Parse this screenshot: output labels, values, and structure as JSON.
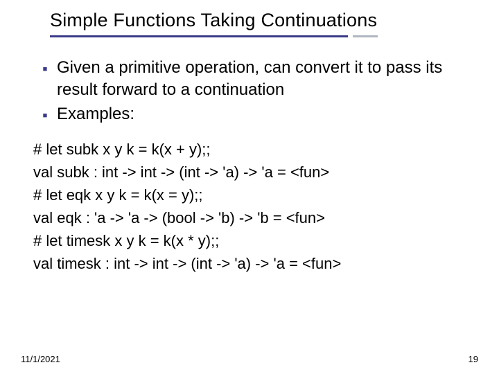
{
  "slide": {
    "title": "Simple Functions Taking Continuations",
    "bullets": [
      "Given a primitive operation, can convert it to pass its result forward to a continuation",
      "Examples:"
    ],
    "code_lines": [
      "# let subk x y k = k(x + y);;",
      "val subk : int -> int -> (int -> 'a) -> 'a = <fun>",
      "# let eqk x y k = k(x = y);;",
      "val eqk : 'a -> 'a -> (bool -> 'b) -> 'b = <fun>",
      "# let timesk x y k = k(x * y);;",
      "val timesk : int -> int -> (int -> 'a) -> 'a = <fun>"
    ],
    "footer_date": "11/1/2021",
    "page_number": "19"
  }
}
